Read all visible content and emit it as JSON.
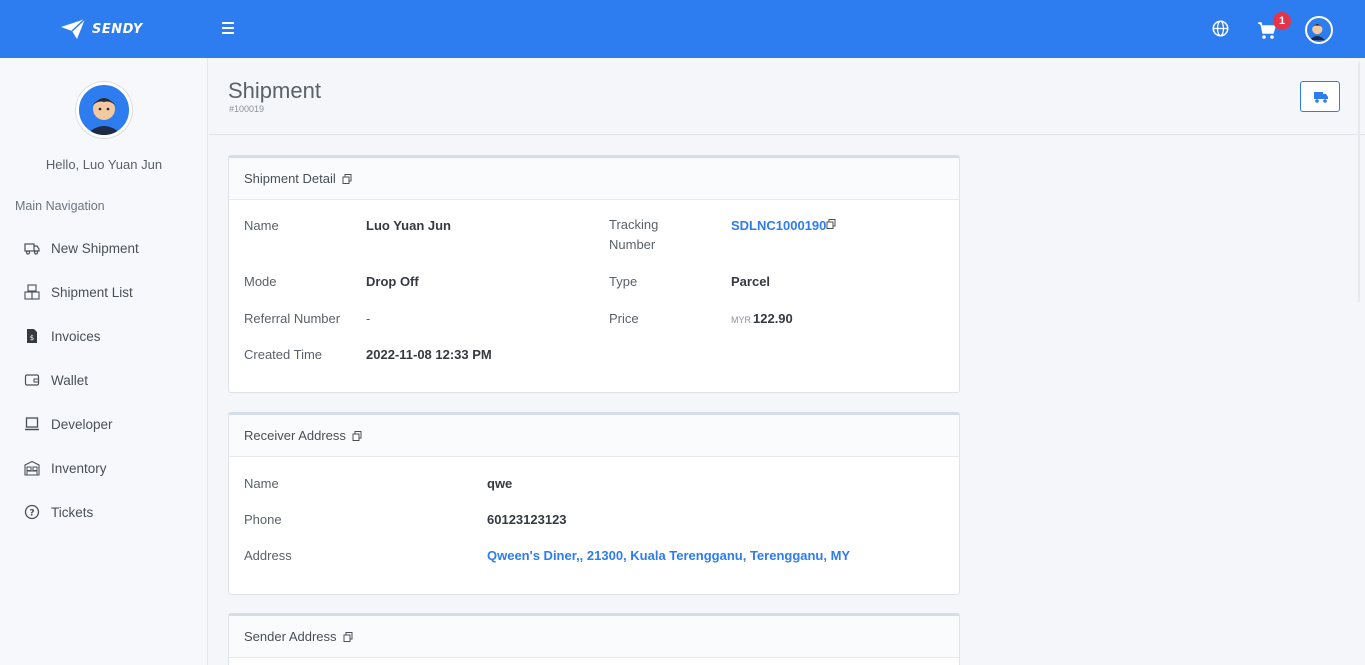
{
  "brand": {
    "name": "SENDY"
  },
  "header": {
    "cart_count": "1"
  },
  "sidebar": {
    "greeting": "Hello, Luo Yuan Jun",
    "nav_heading": "Main Navigation",
    "items": [
      {
        "label": "New Shipment",
        "icon": "truck-icon"
      },
      {
        "label": "Shipment List",
        "icon": "boxes-icon"
      },
      {
        "label": "Invoices",
        "icon": "invoice-icon"
      },
      {
        "label": "Wallet",
        "icon": "wallet-icon"
      },
      {
        "label": "Developer",
        "icon": "laptop-icon"
      },
      {
        "label": "Inventory",
        "icon": "warehouse-icon"
      },
      {
        "label": "Tickets",
        "icon": "help-circle-icon"
      }
    ]
  },
  "page": {
    "title": "Shipment",
    "id": "#100019"
  },
  "shipment_detail": {
    "heading": "Shipment Detail",
    "name_label": "Name",
    "name": "Luo Yuan Jun",
    "tracking_label": "Tracking Number",
    "tracking": "SDLNC1000190",
    "mode_label": "Mode",
    "mode": "Drop Off",
    "type_label": "Type",
    "type": "Parcel",
    "referral_label": "Referral Number",
    "referral": "-",
    "price_label": "Price",
    "currency": "MYR",
    "price": "122.90",
    "created_label": "Created Time",
    "created": "2022-11-08 12:33 PM"
  },
  "receiver": {
    "heading": "Receiver Address",
    "name_label": "Name",
    "name": "qwe",
    "phone_label": "Phone",
    "phone": "60123123123",
    "address_label": "Address",
    "address": "Qween's Diner,, 21300, Kuala Terengganu, Terengganu, MY"
  },
  "sender": {
    "heading": "Sender Address"
  },
  "colors": {
    "primary": "#2d7cf0",
    "badge": "#e4344a"
  }
}
